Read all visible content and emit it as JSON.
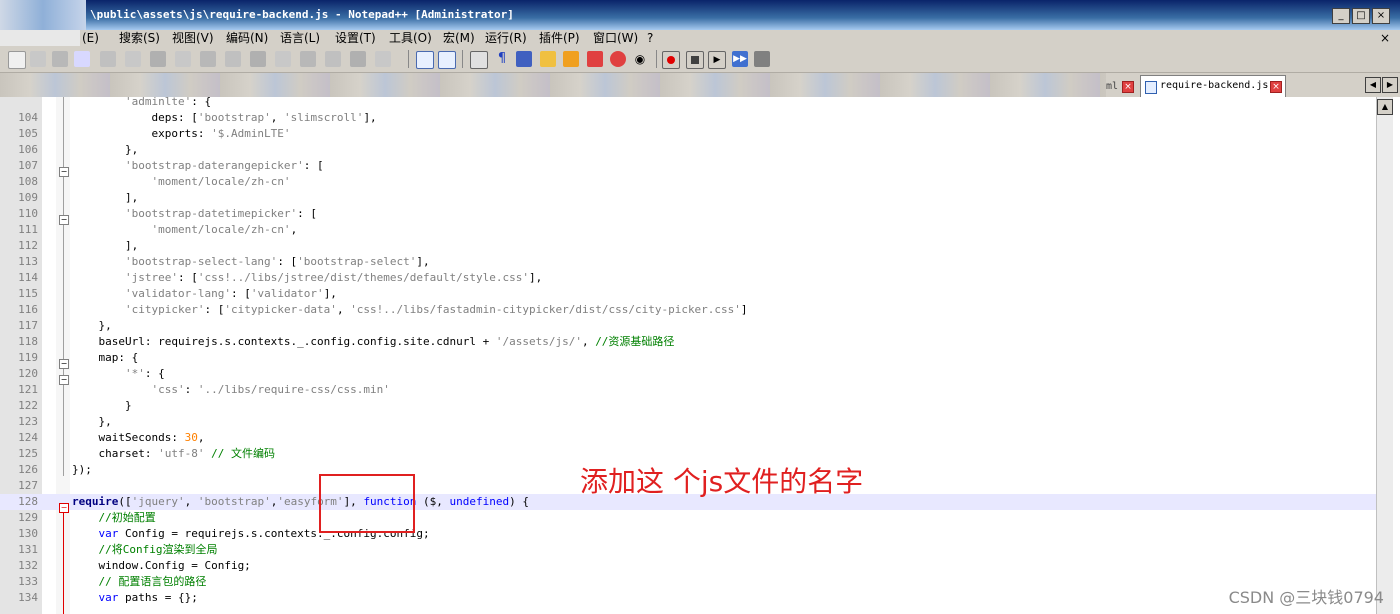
{
  "window": {
    "title": "\\public\\assets\\js\\require-backend.js - Notepad++ [Administrator]",
    "buttons": [
      "_",
      "□",
      "×"
    ]
  },
  "menu": {
    "items": [
      "(E)",
      "搜索(S)",
      "视图(V)",
      "编码(N)",
      "语言(L)",
      "设置(T)",
      "工具(O)",
      "宏(M)",
      "运行(R)",
      "插件(P)",
      "窗口(W)",
      "?"
    ],
    "close_x": "×"
  },
  "tabs": {
    "partial_label": "ml",
    "active_label": "require-backend.js",
    "close_glyph": "×"
  },
  "editor": {
    "lines": [
      {
        "n": "",
        "html": "        <span class='s'>'adminlte'</span>: {"
      },
      {
        "n": "104",
        "html": "            deps: [<span class='s'>'bootstrap'</span>, <span class='s'>'slimscroll'</span>],"
      },
      {
        "n": "105",
        "html": "            exports: <span class='s'>'$.AdminLTE'</span>"
      },
      {
        "n": "106",
        "html": "        },"
      },
      {
        "n": "107",
        "html": "        <span class='s'>'bootstrap-daterangepicker'</span>: ["
      },
      {
        "n": "108",
        "html": "            <span class='s'>'moment/locale/zh-cn'</span>"
      },
      {
        "n": "109",
        "html": "        ],"
      },
      {
        "n": "110",
        "html": "        <span class='s'>'bootstrap-datetimepicker'</span>: ["
      },
      {
        "n": "111",
        "html": "            <span class='s'>'moment/locale/zh-cn'</span>,"
      },
      {
        "n": "112",
        "html": "        ],"
      },
      {
        "n": "113",
        "html": "        <span class='s'>'bootstrap-select-lang'</span>: [<span class='s'>'bootstrap-select'</span>],"
      },
      {
        "n": "114",
        "html": "        <span class='s'>'jstree'</span>: [<span class='s'>'css!../libs/jstree/dist/themes/default/style.css'</span>],"
      },
      {
        "n": "115",
        "html": "        <span class='s'>'validator-lang'</span>: [<span class='s'>'validator'</span>],"
      },
      {
        "n": "116",
        "html": "        <span class='s'>'citypicker'</span>: [<span class='s'>'citypicker-data'</span>, <span class='s'>'css!../libs/fastadmin-citypicker/dist/css/city-picker.css'</span>]"
      },
      {
        "n": "117",
        "html": "    },"
      },
      {
        "n": "118",
        "html": "    baseUrl: requirejs.s.contexts._.config.config.site.cdnurl + <span class='s'>'/assets/js/'</span>, <span class='c'>//资源基础路径</span>"
      },
      {
        "n": "119",
        "html": "    map: {"
      },
      {
        "n": "120",
        "html": "        <span class='s'>'*'</span>: {"
      },
      {
        "n": "121",
        "html": "            <span class='s'>'css'</span>: <span class='s'>'../libs/require-css/css.min'</span>"
      },
      {
        "n": "122",
        "html": "        }"
      },
      {
        "n": "123",
        "html": "    },"
      },
      {
        "n": "124",
        "html": "    waitSeconds: <span class='n'>30</span>,"
      },
      {
        "n": "125",
        "html": "    charset: <span class='s'>'utf-8'</span> <span class='c'>// 文件编码</span>"
      },
      {
        "n": "126",
        "html": "});"
      },
      {
        "n": "127",
        "html": ""
      },
      {
        "n": "128",
        "html": "<span class='b'>require</span>([<span class='s'>'jquery'</span>, <span class='s'>'bootstrap'</span>,<span class='s'>'easyform'</span>], <span class='k'>function</span> ($, <span class='k'>undefined</span>) {"
      },
      {
        "n": "129",
        "html": "    <span class='c'>//初始配置</span>"
      },
      {
        "n": "130",
        "html": "    <span class='k'>var</span> Config = requirejs.s.contexts._.config.config;"
      },
      {
        "n": "131",
        "html": "    <span class='c'>//将Config渲染到全局</span>"
      },
      {
        "n": "132",
        "html": "    window.Config = Config;"
      },
      {
        "n": "133",
        "html": "    <span class='c'>// 配置语言包的路径</span>"
      },
      {
        "n": "134",
        "html": "    <span class='k'>var</span> paths = {};"
      }
    ]
  },
  "annotation": {
    "text": "添加这 个js文件的名字"
  },
  "watermark": "CSDN @三块钱0794"
}
